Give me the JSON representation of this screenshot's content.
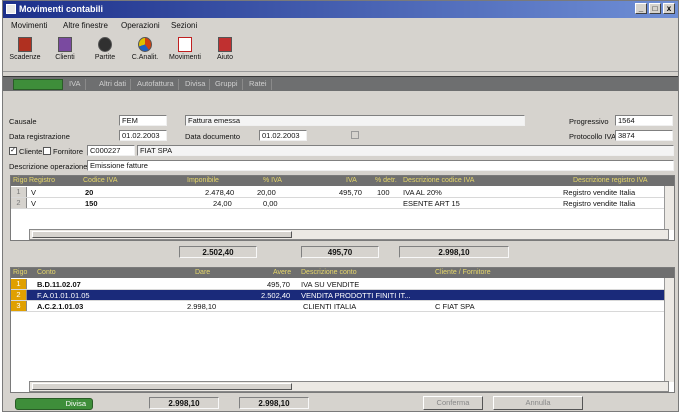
{
  "window": {
    "title": "Movimenti contabili",
    "min": "_",
    "max": "□",
    "close": "x"
  },
  "menu": [
    "Movimenti",
    "Altre finestre",
    "Operazioni",
    "Sezioni"
  ],
  "toolbar": [
    {
      "label": "Scadenze",
      "icon": "calendar-icon",
      "color": "#b03020"
    },
    {
      "label": "Clienti",
      "icon": "people-icon",
      "color": "#7a4aa0"
    },
    {
      "label": "Partite",
      "icon": "gear-icon",
      "color": "#303030"
    },
    {
      "label": "C.Analit.",
      "icon": "pie-chart-icon",
      "color": "#d04010"
    },
    {
      "label": "Movimenti",
      "icon": "document-icon",
      "color": "#c02020"
    },
    {
      "label": "Aiuto",
      "icon": "help-icon",
      "color": "#c03030"
    }
  ],
  "tabs": [
    "IVA",
    "Altri dati",
    "Autofattura",
    "Divisa",
    "Gruppi",
    "Ratei"
  ],
  "form": {
    "causale_label": "Causale",
    "causale_value": "FEM",
    "causale_desc": "Fattura emessa",
    "progressivo_label": "Progressivo",
    "progressivo_value": "1564",
    "data_reg_label": "Data registrazione",
    "data_reg_value": "01.02.2003",
    "data_doc_label": "Data documento",
    "data_doc_value": "01.02.2003",
    "protocollo_label": "Protocollo IVA",
    "protocollo_value": "3874",
    "cliente_label": "Cliente",
    "fornitore_label": "Fornitore",
    "cliente_code": "C000227",
    "cliente_name": "FIAT SPA",
    "descr_label": "Descrizione operazione",
    "descr_value": "Emissione fatture"
  },
  "iva_grid": {
    "headers": [
      "Rigo",
      "Registro",
      "Codice IVA",
      "Imponibile",
      "% IVA",
      "IVA",
      "% detr.",
      "Descrizione codice IVA",
      "Descrizione registro IVA"
    ],
    "rows": [
      {
        "n": "1",
        "registro": "V",
        "codice": "20",
        "imponibile": "2.478,40",
        "perc": "20,00",
        "iva": "495,70",
        "detr": "100",
        "descr": "IVA AL 20%",
        "registro_descr": "Registro vendite Italia"
      },
      {
        "n": "2",
        "registro": "V",
        "codice": "150",
        "imponibile": "24,00",
        "perc": "0,00",
        "iva": "",
        "detr": "",
        "descr": "ESENTE ART 15",
        "registro_descr": "Registro vendite Italia"
      }
    ]
  },
  "totals1": {
    "imponibile": "2.502,40",
    "iva": "495,70",
    "totale": "2.998,10"
  },
  "conto_grid": {
    "headers": [
      "Rigo",
      "Conto",
      "Dare",
      "Avere",
      "Descrizione conto",
      "Cliente / Fornitore"
    ],
    "rows": [
      {
        "n": "1",
        "conto": "B.D.11.02.07",
        "dare": "",
        "avere": "495,70",
        "descr": "IVA SU VENDITE",
        "cliente": ""
      },
      {
        "n": "2",
        "conto": "F.A.01.01.01.05",
        "dare": "",
        "avere": "2.502,40",
        "descr": "VENDITA PRODOTTI FINITI IT...",
        "cliente": ""
      },
      {
        "n": "3",
        "conto": "A.C.2.1.01.03",
        "dare": "2.998,10",
        "avere": "",
        "descr": "CLIENTI ITALIA",
        "cliente": "C  FIAT SPA"
      }
    ]
  },
  "footer": {
    "status": "Divisa",
    "dare_total": "2.998,10",
    "avere_total": "2.998,10",
    "btn1": "Conferma",
    "btn2": "Annulla"
  }
}
